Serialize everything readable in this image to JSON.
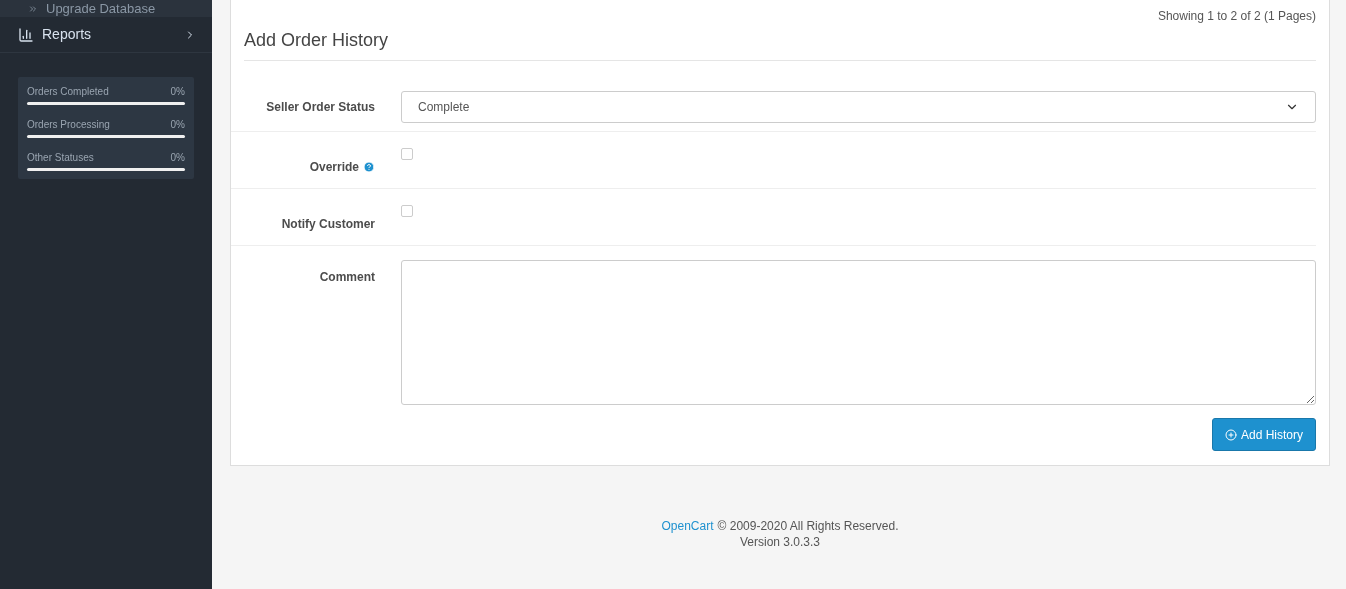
{
  "sidebar": {
    "items": [
      {
        "kind": "subitem",
        "label": "Upgrade Database"
      },
      {
        "kind": "menu",
        "label": "Reports"
      }
    ],
    "stats": [
      {
        "label": "Orders Completed",
        "reading": "0%",
        "level": 0
      },
      {
        "label": "Orders Processing",
        "reading": "0%",
        "level": 0
      },
      {
        "label": "Other Statuses",
        "reading": "0%",
        "level": 0
      }
    ]
  },
  "pagination_text": "Showing 1 to 2 of 2 (1 Pages)",
  "form": {
    "title": "Add Order History",
    "fields": [
      {
        "kind": "select",
        "label": "Seller Order Status",
        "value": "Complete"
      },
      {
        "kind": "checkbox",
        "label": "Override",
        "help": true,
        "checked": false
      },
      {
        "kind": "checkbox",
        "label": "Notify Customer",
        "help": false,
        "checked": false
      },
      {
        "kind": "textarea",
        "label": "Comment"
      }
    ],
    "button": "Add History"
  },
  "footer": {
    "link": "OpenCart",
    "text": "© 2009-2020 All Rights Reserved.",
    "version": "Version 3.0.3.3"
  }
}
